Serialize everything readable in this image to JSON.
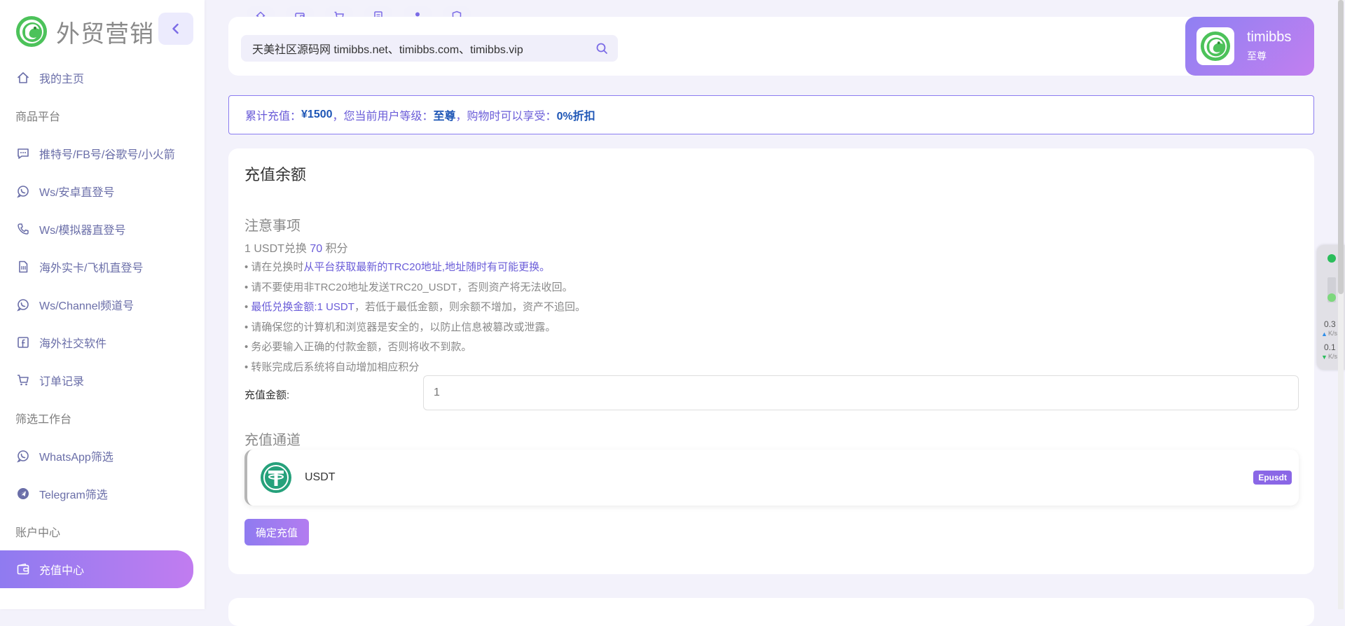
{
  "brand": {
    "name": "外贸营销",
    "logo_icon": "green-dragon-logo-icon"
  },
  "sidebar": {
    "items": [
      {
        "kind": "link",
        "label": "我的主页",
        "icon": "home-icon"
      },
      {
        "kind": "section",
        "label": "商品平台"
      },
      {
        "kind": "link",
        "label": "推特号/FB号/谷歌号/小火箭",
        "icon": "chat-icon"
      },
      {
        "kind": "link",
        "label": "Ws/安卓直登号",
        "icon": "whatsapp-icon"
      },
      {
        "kind": "link",
        "label": "Ws/模拟器直登号",
        "icon": "phone-icon"
      },
      {
        "kind": "link",
        "label": "海外实卡/飞机直登号",
        "icon": "sim-card-icon"
      },
      {
        "kind": "link",
        "label": "Ws/Channel频道号",
        "icon": "whatsapp-icon"
      },
      {
        "kind": "link",
        "label": "海外社交软件",
        "icon": "facebook-icon"
      },
      {
        "kind": "link",
        "label": "订单记录",
        "icon": "cart-icon"
      },
      {
        "kind": "section",
        "label": "筛选工作台"
      },
      {
        "kind": "link",
        "label": "WhatsApp筛选",
        "icon": "whatsapp-icon"
      },
      {
        "kind": "link",
        "label": "Telegram筛选",
        "icon": "telegram-icon"
      },
      {
        "kind": "section",
        "label": "账户中心"
      },
      {
        "kind": "link",
        "label": "充值中心",
        "icon": "wallet-icon",
        "active": true
      }
    ]
  },
  "header": {
    "tabs": [
      "home-icon",
      "wallet-icon",
      "cart-icon",
      "document-icon",
      "user-icon",
      "shield-icon"
    ],
    "search_value": "天美社区源码网 timibbs.net、timibbs.com、timibbs.vip",
    "user": {
      "name": "timibbs",
      "level": "至尊"
    }
  },
  "notice": {
    "p1": "累计充值：",
    "total": "¥1500",
    "p2": "，您当前用户等级：",
    "level": "至尊",
    "p3": "，购物时可以享受：",
    "discount": "0%折扣"
  },
  "recharge": {
    "title": "充值余额",
    "note_title": "注意事项",
    "rate_pre": "1 USDT兑换 ",
    "rate_value": "70",
    "rate_post": " 积分",
    "notes": [
      {
        "pre": "• 请在兑换时",
        "hl": "从平台获取最新的TRC20地址,地址随时有可能更换。",
        "post": ""
      },
      {
        "pre": "• 请不要使用非TRC20地址发送TRC20_USDT，否则资产将无法收回。",
        "hl": "",
        "post": ""
      },
      {
        "pre": "• ",
        "hl": "最低兑换金额:1 USDT",
        "post": "，若低于最低金额，则余额不增加，资产不追回。"
      },
      {
        "pre": "• 请确保您的计算机和浏览器是安全的，以防止信息被篡改或泄露。",
        "hl": "",
        "post": ""
      },
      {
        "pre": "• 务必要输入正确的付款金额，否则将收不到款。",
        "hl": "",
        "post": ""
      },
      {
        "pre": "• 转账完成后系统将自动增加相应积分",
        "hl": "",
        "post": ""
      }
    ],
    "amount_label": "充值金额:",
    "amount_placeholder": "1",
    "channel_title": "充值通道",
    "channel": {
      "name": "USDT",
      "badge": "Epusdt",
      "icon": "usdt-tether-icon"
    },
    "confirm_label": "确定充值"
  },
  "net_widget": {
    "up_speed": "0.3",
    "down_speed": "0.1",
    "unit": "K/s"
  },
  "colors": {
    "accent": "#8f7bf0",
    "accent_end": "#c17cf0",
    "highlight": "#1e56b6",
    "usdt_green": "#26a17b"
  }
}
